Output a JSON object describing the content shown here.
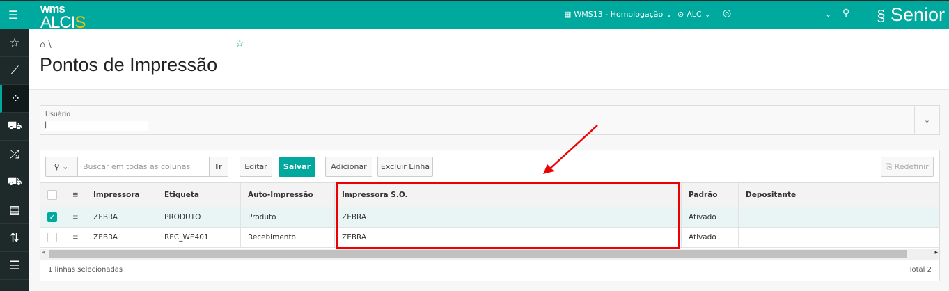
{
  "header": {
    "logo_top": "wms",
    "logo_main": "ALCI",
    "logo_accent": "S",
    "environment": "WMS13 - Homologação",
    "location": "ALC",
    "brand": "Senior"
  },
  "sidebar": {
    "items": [
      {
        "icon": "star-icon"
      },
      {
        "icon": "chart-icon"
      },
      {
        "icon": "apps-icon",
        "active": true
      },
      {
        "icon": "truck-icon"
      },
      {
        "icon": "shuffle-icon"
      },
      {
        "icon": "delivery-icon"
      },
      {
        "icon": "clipboard-icon"
      },
      {
        "icon": "sync-icon"
      },
      {
        "icon": "checklist-icon"
      }
    ]
  },
  "breadcrumb": {
    "separator": "\\"
  },
  "page": {
    "title": "Pontos de Impressão"
  },
  "filter": {
    "label": "Usuário",
    "value": "|"
  },
  "toolbar": {
    "search_placeholder": "Buscar em todas as colunas",
    "go": "Ir",
    "edit": "Editar",
    "save": "Salvar",
    "add": "Adicionar",
    "delete": "Excluir Linha",
    "reset": "Redefinir"
  },
  "grid": {
    "columns": [
      "Impressora",
      "Etiqueta",
      "Auto-Impressão",
      "Impressora S.O.",
      "Padrão",
      "Depositante"
    ],
    "rows": [
      {
        "selected": true,
        "cells": [
          "ZEBRA",
          "PRODUTO",
          "Produto",
          "ZEBRA",
          "Ativado",
          ""
        ]
      },
      {
        "selected": false,
        "cells": [
          "ZEBRA",
          "REC_WE401",
          "Recebimento",
          "ZEBRA",
          "Ativado",
          ""
        ]
      }
    ],
    "selected_text": "1 linhas selecionadas",
    "total": "Total 2"
  },
  "colors": {
    "accent": "#00a99d",
    "annotation": "#e00000"
  }
}
